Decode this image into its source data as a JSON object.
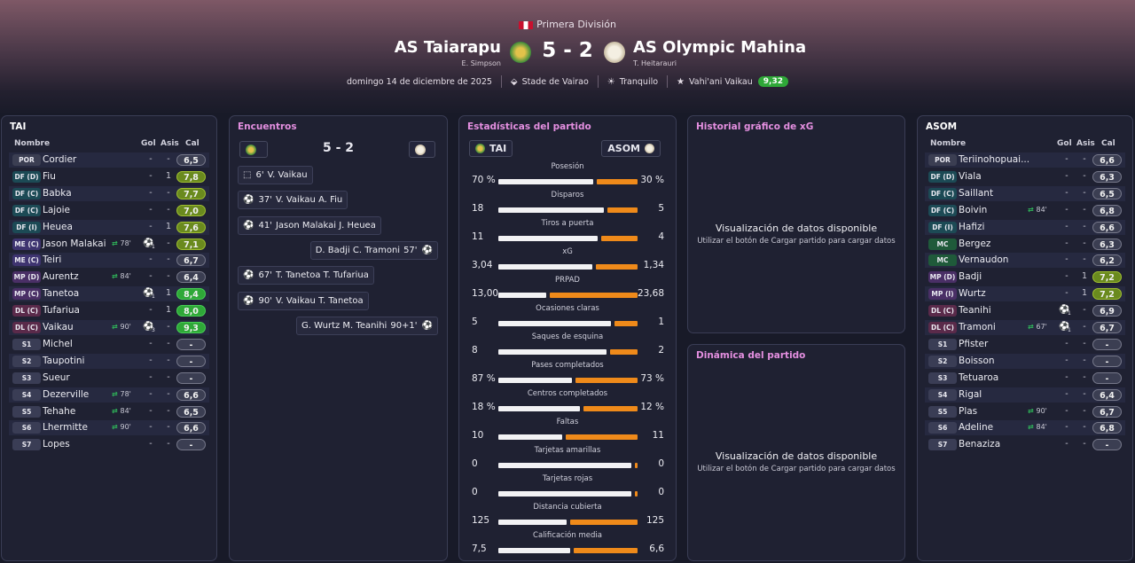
{
  "header": {
    "competition": "Primera División",
    "home": {
      "name": "AS Taiarapu",
      "manager": "E. Simpson"
    },
    "away": {
      "name": "AS Olympic Mahina",
      "manager": "T. Heitarauri"
    },
    "score": "5 - 2",
    "date": "domingo 14 de diciembre de 2025",
    "stadium": "Stade de Vairao",
    "weather": "Tranquilo",
    "potm_name": "Vahi'ani Vaikau",
    "potm_rating": "9,32"
  },
  "lineups": {
    "col_name": "Nombre",
    "col_goals": "Gol",
    "col_assists": "Asis",
    "col_rating": "Cal",
    "home": {
      "title": "TAI",
      "players": [
        {
          "pos": "POR",
          "name": "Cordier",
          "goals": "-",
          "assists": "-",
          "rating": "6,5",
          "sub": "",
          "ball": "",
          "ballcount": ""
        },
        {
          "pos": "DF (D)",
          "name": "Fiu",
          "goals": "-",
          "assists": "1",
          "rating": "7,8",
          "sub": "",
          "ball": "",
          "ballcount": ""
        },
        {
          "pos": "DF (C)",
          "name": "Babka",
          "goals": "-",
          "assists": "-",
          "rating": "7,7",
          "sub": "",
          "ball": "",
          "ballcount": ""
        },
        {
          "pos": "DF (C)",
          "name": "Lajoie",
          "goals": "-",
          "assists": "-",
          "rating": "7,0",
          "sub": "",
          "ball": "",
          "ballcount": ""
        },
        {
          "pos": "DF (I)",
          "name": "Heuea",
          "goals": "-",
          "assists": "1",
          "rating": "7,6",
          "sub": "",
          "ball": "",
          "ballcount": ""
        },
        {
          "pos": "ME (C)",
          "name": "Jason Malakai",
          "goals": "-",
          "assists": "-",
          "rating": "7,1",
          "sub": "78'",
          "ball": "⚽",
          "ballcount": "1"
        },
        {
          "pos": "ME (C)",
          "name": "Teiri",
          "goals": "-",
          "assists": "-",
          "rating": "6,7",
          "sub": "",
          "ball": "",
          "ballcount": ""
        },
        {
          "pos": "MP (D)",
          "name": "Aurentz",
          "goals": "-",
          "assists": "-",
          "rating": "6,4",
          "sub": "84'",
          "ball": "",
          "ballcount": ""
        },
        {
          "pos": "MP (C)",
          "name": "Tanetoa",
          "goals": "-",
          "assists": "1",
          "rating": "8,4",
          "sub": "",
          "ball": "⚽",
          "ballcount": "1"
        },
        {
          "pos": "DL (C)",
          "name": "Tufariua",
          "goals": "-",
          "assists": "1",
          "rating": "8,0",
          "sub": "",
          "ball": "",
          "ballcount": ""
        },
        {
          "pos": "DL (C)",
          "name": "Vaikau",
          "goals": "-",
          "assists": "-",
          "rating": "9,3",
          "sub": "90'",
          "ball": "⚽",
          "ballcount": "3"
        },
        {
          "pos": "S1",
          "name": "Michel",
          "goals": "-",
          "assists": "-",
          "rating": "-",
          "sub": "",
          "ball": "",
          "ballcount": ""
        },
        {
          "pos": "S2",
          "name": "Taupotini",
          "goals": "-",
          "assists": "-",
          "rating": "-",
          "sub": "",
          "ball": "",
          "ballcount": ""
        },
        {
          "pos": "S3",
          "name": "Sueur",
          "goals": "-",
          "assists": "-",
          "rating": "-",
          "sub": "",
          "ball": "",
          "ballcount": ""
        },
        {
          "pos": "S4",
          "name": "Dezerville",
          "goals": "-",
          "assists": "-",
          "rating": "6,6",
          "sub": "78'",
          "ball": "",
          "ballcount": ""
        },
        {
          "pos": "S5",
          "name": "Tehahe",
          "goals": "-",
          "assists": "-",
          "rating": "6,5",
          "sub": "84'",
          "ball": "",
          "ballcount": ""
        },
        {
          "pos": "S6",
          "name": "Lhermitte",
          "goals": "-",
          "assists": "-",
          "rating": "6,6",
          "sub": "90'",
          "ball": "",
          "ballcount": ""
        },
        {
          "pos": "S7",
          "name": "Lopes",
          "goals": "-",
          "assists": "-",
          "rating": "-",
          "sub": "",
          "ball": "",
          "ballcount": ""
        }
      ]
    },
    "away": {
      "title": "ASOM",
      "players": [
        {
          "pos": "POR",
          "name": "Teriinohopuai...",
          "goals": "-",
          "assists": "-",
          "rating": "6,6",
          "sub": "",
          "ball": "",
          "ballcount": ""
        },
        {
          "pos": "DF (D)",
          "name": "Viala",
          "goals": "-",
          "assists": "-",
          "rating": "6,3",
          "sub": "",
          "ball": "",
          "ballcount": ""
        },
        {
          "pos": "DF (C)",
          "name": "Saillant",
          "goals": "-",
          "assists": "-",
          "rating": "6,5",
          "sub": "",
          "ball": "",
          "ballcount": ""
        },
        {
          "pos": "DF (C)",
          "name": "Boivin",
          "goals": "-",
          "assists": "-",
          "rating": "6,8",
          "sub": "84'",
          "ball": "",
          "ballcount": ""
        },
        {
          "pos": "DF (I)",
          "name": "Hafizi",
          "goals": "-",
          "assists": "-",
          "rating": "6,6",
          "sub": "",
          "ball": "",
          "ballcount": ""
        },
        {
          "pos": "MC",
          "name": "Bergez",
          "goals": "-",
          "assists": "-",
          "rating": "6,3",
          "sub": "",
          "ball": "",
          "ballcount": ""
        },
        {
          "pos": "MC",
          "name": "Vernaudon",
          "goals": "-",
          "assists": "-",
          "rating": "6,2",
          "sub": "",
          "ball": "",
          "ballcount": ""
        },
        {
          "pos": "MP (D)",
          "name": "Badji",
          "goals": "-",
          "assists": "1",
          "rating": "7,2",
          "sub": "",
          "ball": "",
          "ballcount": ""
        },
        {
          "pos": "MP (I)",
          "name": "Wurtz",
          "goals": "-",
          "assists": "1",
          "rating": "7,2",
          "sub": "",
          "ball": "",
          "ballcount": ""
        },
        {
          "pos": "DL (C)",
          "name": "Teanihi",
          "goals": "-",
          "assists": "-",
          "rating": "6,9",
          "sub": "",
          "ball": "⚽",
          "ballcount": "1"
        },
        {
          "pos": "DL (C)",
          "name": "Tramoni",
          "goals": "-",
          "assists": "-",
          "rating": "6,7",
          "sub": "67'",
          "ball": "⚽",
          "ballcount": "1"
        },
        {
          "pos": "S1",
          "name": "Pfister",
          "goals": "-",
          "assists": "-",
          "rating": "-",
          "sub": "",
          "ball": "",
          "ballcount": ""
        },
        {
          "pos": "S2",
          "name": "Boisson",
          "goals": "-",
          "assists": "-",
          "rating": "-",
          "sub": "",
          "ball": "",
          "ballcount": ""
        },
        {
          "pos": "S3",
          "name": "Tetuaroa",
          "goals": "-",
          "assists": "-",
          "rating": "-",
          "sub": "",
          "ball": "",
          "ballcount": ""
        },
        {
          "pos": "S4",
          "name": "Rigal",
          "goals": "-",
          "assists": "-",
          "rating": "6,4",
          "sub": "",
          "ball": "",
          "ballcount": ""
        },
        {
          "pos": "S5",
          "name": "Plas",
          "goals": "-",
          "assists": "-",
          "rating": "6,7",
          "sub": "90'",
          "ball": "",
          "ballcount": ""
        },
        {
          "pos": "S6",
          "name": "Adeline",
          "goals": "-",
          "assists": "-",
          "rating": "6,8",
          "sub": "84'",
          "ball": "",
          "ballcount": ""
        },
        {
          "pos": "S7",
          "name": "Benaziza",
          "goals": "-",
          "assists": "-",
          "rating": "-",
          "sub": "",
          "ball": "",
          "ballcount": ""
        }
      ]
    }
  },
  "events": {
    "title": "Encuentros",
    "score": "5 - 2",
    "items": [
      {
        "side": "home",
        "minute": "6'",
        "text": "V. Vaikau",
        "icon": "penalty"
      },
      {
        "side": "home",
        "minute": "37'",
        "text": "V. Vaikau  A. Fiu",
        "icon": "ball"
      },
      {
        "side": "home",
        "minute": "41'",
        "text": "Jason Malakai  J. Heuea",
        "icon": "ball"
      },
      {
        "side": "away",
        "minute": "57'",
        "text": "D. Badji  C. Tramoni",
        "icon": "ball"
      },
      {
        "side": "home",
        "minute": "67'",
        "text": "T. Tanetoa  T. Tufariua",
        "icon": "ball"
      },
      {
        "side": "home",
        "minute": "90'",
        "text": "V. Vaikau  T. Tanetoa",
        "icon": "ball"
      },
      {
        "side": "away",
        "minute": "90+1'",
        "text": "G. Wurtz  M. Teanihi",
        "icon": "ball"
      }
    ]
  },
  "stats": {
    "title": "Estadísticas del partido",
    "home_label": "TAI",
    "away_label": "ASOM",
    "rows": [
      {
        "label": "Posesión",
        "home": "70 %",
        "away": "30 %",
        "home_share": 0.7
      },
      {
        "label": "Disparos",
        "home": "18",
        "away": "5",
        "home_share": 0.78
      },
      {
        "label": "Tiros a puerta",
        "home": "11",
        "away": "4",
        "home_share": 0.73
      },
      {
        "label": "xG",
        "home": "3,04",
        "away": "1,34",
        "home_share": 0.69
      },
      {
        "label": "PRPAD",
        "home": "13,00",
        "away": "23,68",
        "home_share": 0.35
      },
      {
        "label": "Ocasiones claras",
        "home": "5",
        "away": "1",
        "home_share": 0.83
      },
      {
        "label": "Saques de esquina",
        "home": "8",
        "away": "2",
        "home_share": 0.8
      },
      {
        "label": "Pases completados",
        "home": "87 %",
        "away": "73 %",
        "home_share": 0.54
      },
      {
        "label": "Centros completados",
        "home": "18 %",
        "away": "12 %",
        "home_share": 0.6
      },
      {
        "label": "Faltas",
        "home": "10",
        "away": "11",
        "home_share": 0.47
      },
      {
        "label": "Tarjetas amarillas",
        "home": "0",
        "away": "0",
        "home_share": 0.98
      },
      {
        "label": "Tarjetas rojas",
        "home": "0",
        "away": "0",
        "home_share": 0.98
      },
      {
        "label": "Distancia cubierta",
        "home": "125",
        "away": "125",
        "home_share": 0.5
      },
      {
        "label": "Calificación media",
        "home": "7,5",
        "away": "6,6",
        "home_share": 0.53
      }
    ]
  },
  "xg_panel": {
    "title": "Historial gráfico de xG",
    "line1": "Visualización de datos disponible",
    "line2": "Utilizar el botón de Cargar partido para cargar datos"
  },
  "dyn_panel": {
    "title": "Dinámica del partido",
    "line1": "Visualización de datos disponible",
    "line2": "Utilizar el botón de Cargar partido para cargar datos"
  },
  "colors": {
    "accent_pink": "#e48fe0",
    "rating_green": "#2fa838",
    "bar_orange": "#ef8a1a"
  }
}
